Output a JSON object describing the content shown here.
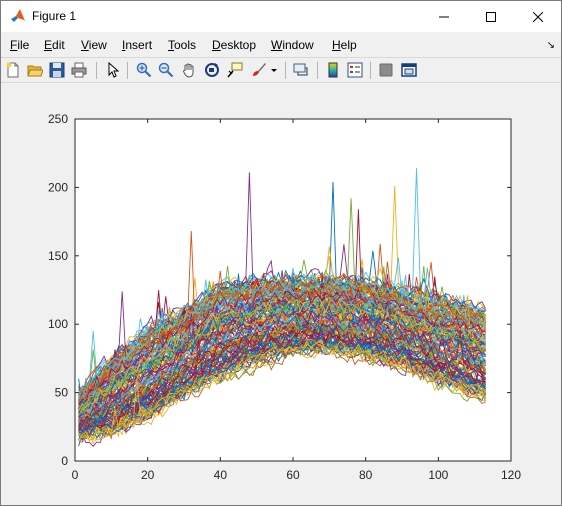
{
  "window": {
    "title": "Figure 1",
    "app_icon": "matlab-logo-icon",
    "controls": [
      "minimize-icon",
      "maximize-icon",
      "close-icon"
    ]
  },
  "menu": {
    "items": [
      {
        "label": "File",
        "underline": "F",
        "rest": "ile"
      },
      {
        "label": "Edit",
        "underline": "E",
        "rest": "dit"
      },
      {
        "label": "View",
        "underline": "V",
        "rest": "iew"
      },
      {
        "label": "Insert",
        "underline": "I",
        "rest": "nsert"
      },
      {
        "label": "Tools",
        "underline": "T",
        "rest": "ools"
      },
      {
        "label": "Desktop",
        "underline": "D",
        "rest": "esktop"
      },
      {
        "label": "Window",
        "underline": "W",
        "rest": "indow"
      },
      {
        "label": "Help",
        "underline": "H",
        "rest": "elp"
      }
    ],
    "dock_icon": "dock-arrow-icon"
  },
  "toolbar": {
    "icons": [
      "new-figure-icon",
      "open-file-icon",
      "save-icon",
      "print-icon",
      "edit-plot-arrow-icon",
      "zoom-in-icon",
      "zoom-out-icon",
      "pan-hand-icon",
      "rotate-3d-icon",
      "data-cursor-icon",
      "brush-icon",
      "link-plot-icon",
      "colorbar-icon",
      "legend-icon",
      "hide-plot-tools-icon",
      "show-plot-tools-icon"
    ]
  },
  "chart_data": {
    "type": "line",
    "title": "",
    "xlabel": "",
    "ylabel": "",
    "xlim": [
      0,
      120
    ],
    "ylim": [
      0,
      250
    ],
    "xticks": [
      0,
      20,
      40,
      60,
      80,
      100,
      120
    ],
    "yticks": [
      0,
      50,
      100,
      150,
      200,
      250
    ],
    "grid": false,
    "legend": "none",
    "x_range_of_series": [
      1,
      113
    ],
    "series_count": 150,
    "color_order": [
      "#0072BD",
      "#D95319",
      "#EDB120",
      "#7E2F8E",
      "#77AC30",
      "#4DBEEE",
      "#A2142F"
    ],
    "envelope": {
      "x": [
        1,
        10,
        20,
        30,
        40,
        50,
        60,
        70,
        80,
        90,
        100,
        113
      ],
      "lower": [
        15,
        20,
        30,
        45,
        60,
        70,
        78,
        80,
        75,
        68,
        55,
        45
      ],
      "upper": [
        50,
        75,
        95,
        110,
        128,
        132,
        133,
        132,
        130,
        125,
        118,
        110
      ]
    },
    "peaks": [
      {
        "x": 48,
        "y": 211
      },
      {
        "x": 94,
        "y": 214
      },
      {
        "x": 71,
        "y": 204
      },
      {
        "x": 88,
        "y": 201
      },
      {
        "x": 76,
        "y": 192
      },
      {
        "x": 78,
        "y": 184
      },
      {
        "x": 32,
        "y": 168
      },
      {
        "x": 13,
        "y": 124
      },
      {
        "x": 5,
        "y": 95
      }
    ]
  }
}
